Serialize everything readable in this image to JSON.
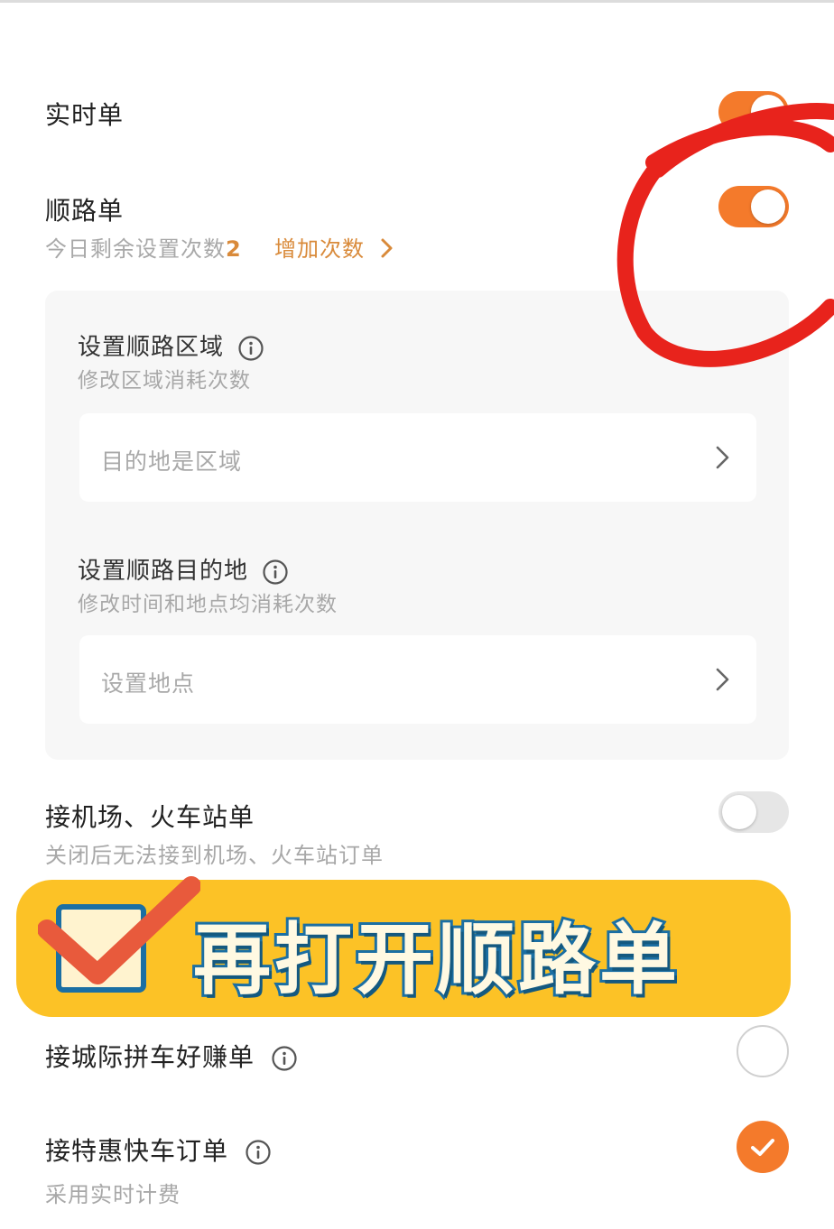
{
  "realtime": {
    "title": "实时单",
    "enabled": true
  },
  "along_route": {
    "title": "顺路单",
    "remaining_label": "今日剩余设置次数",
    "remaining_count": "2",
    "add_link": "增加次数",
    "enabled": true
  },
  "route_area": {
    "title": "设置顺路区域",
    "subtitle": "修改区域消耗次数",
    "placeholder": "目的地是区域"
  },
  "route_destination": {
    "title": "设置顺路目的地",
    "subtitle": "修改时间和地点均消耗次数",
    "placeholder": "设置地点"
  },
  "airport_station": {
    "title": "接机场、火车站单",
    "subtitle": "关闭后无法接到机场、火车站订单",
    "enabled": false
  },
  "banner": {
    "text": "再打开顺路单"
  },
  "intercity": {
    "title": "接城际拼车好赚单",
    "checked": false
  },
  "discount_express": {
    "title": "接特惠快车订单",
    "subtitle": "采用实时计费",
    "checked": true
  },
  "colors": {
    "accent": "#f47a2b",
    "link": "#d98a3a",
    "annotation_red": "#e8231c",
    "banner_yellow": "#fcc226",
    "banner_outline": "#1b6fa3"
  }
}
